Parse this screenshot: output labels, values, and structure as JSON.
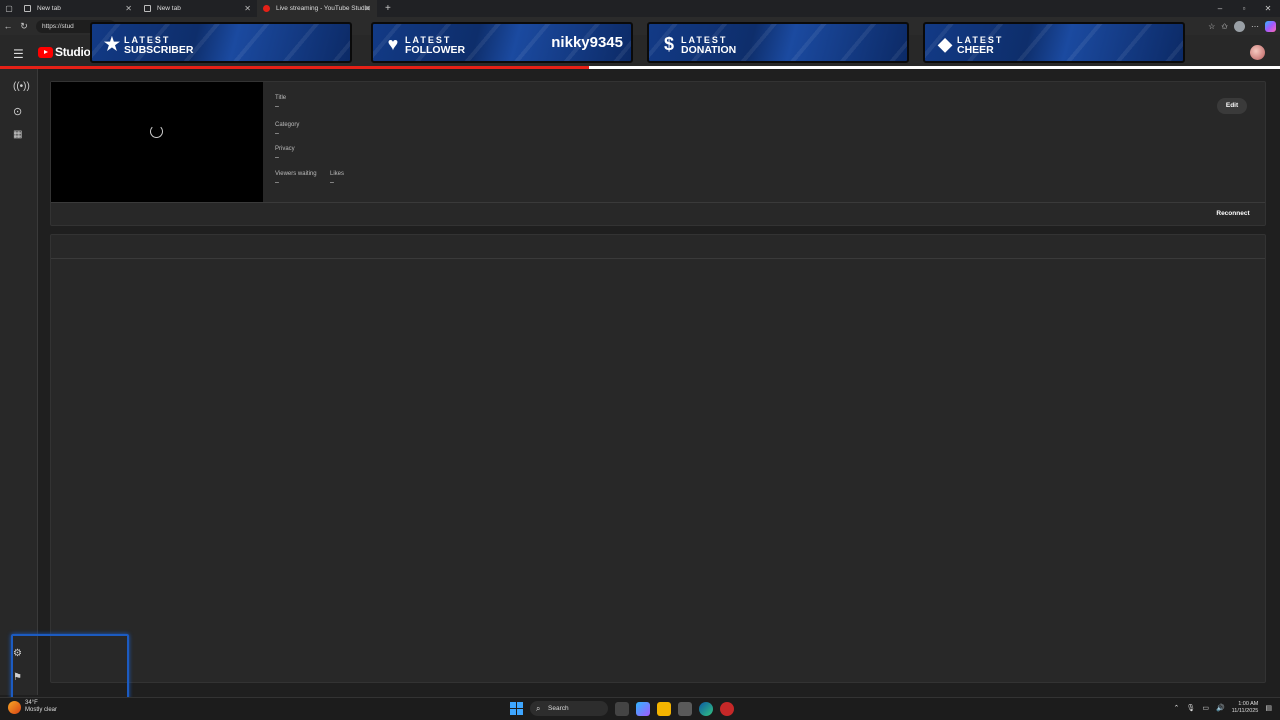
{
  "browser": {
    "tabs": [
      {
        "label": "New tab",
        "active": false
      },
      {
        "label": "New tab",
        "active": false
      },
      {
        "label": "Live streaming - YouTube Studio",
        "active": true
      }
    ],
    "new_tab_icon": "+",
    "url": "https://stud",
    "window_controls": [
      "–",
      "▫",
      "✕"
    ]
  },
  "studio": {
    "logo_text": "Studio",
    "upload_progress_fraction": 0.46
  },
  "overlay": {
    "banners": [
      {
        "icon": "★",
        "line1": "LATEST",
        "line2": "SUBSCRIBER",
        "name": ""
      },
      {
        "icon": "♥",
        "line1": "LATEST",
        "line2": "FOLLOWER",
        "name": "nikky9345"
      },
      {
        "icon": "$",
        "line1": "LATEST",
        "line2": "DONATION",
        "name": ""
      },
      {
        "icon": "◆",
        "line1": "LATEST",
        "line2": "CHEER",
        "name": ""
      }
    ]
  },
  "stream": {
    "title_label": "Title",
    "title_value": "–",
    "category_label": "Category",
    "category_value": "–",
    "privacy_label": "Privacy",
    "privacy_value": "–",
    "viewers_label": "Viewers waiting",
    "viewers_value": "–",
    "likes_label": "Likes",
    "likes_value": "–",
    "edit_label": "Edit",
    "reconnect_label": "Reconnect"
  },
  "taskbar": {
    "weather_temp": "34°F",
    "weather_desc": "Mostly clear",
    "search_label": "Search",
    "time": "1:00 AM",
    "date": "11/11/2025"
  },
  "colors": {
    "accent": "#e62117",
    "banner": "#123a86",
    "bg": "#1f1f1f"
  }
}
